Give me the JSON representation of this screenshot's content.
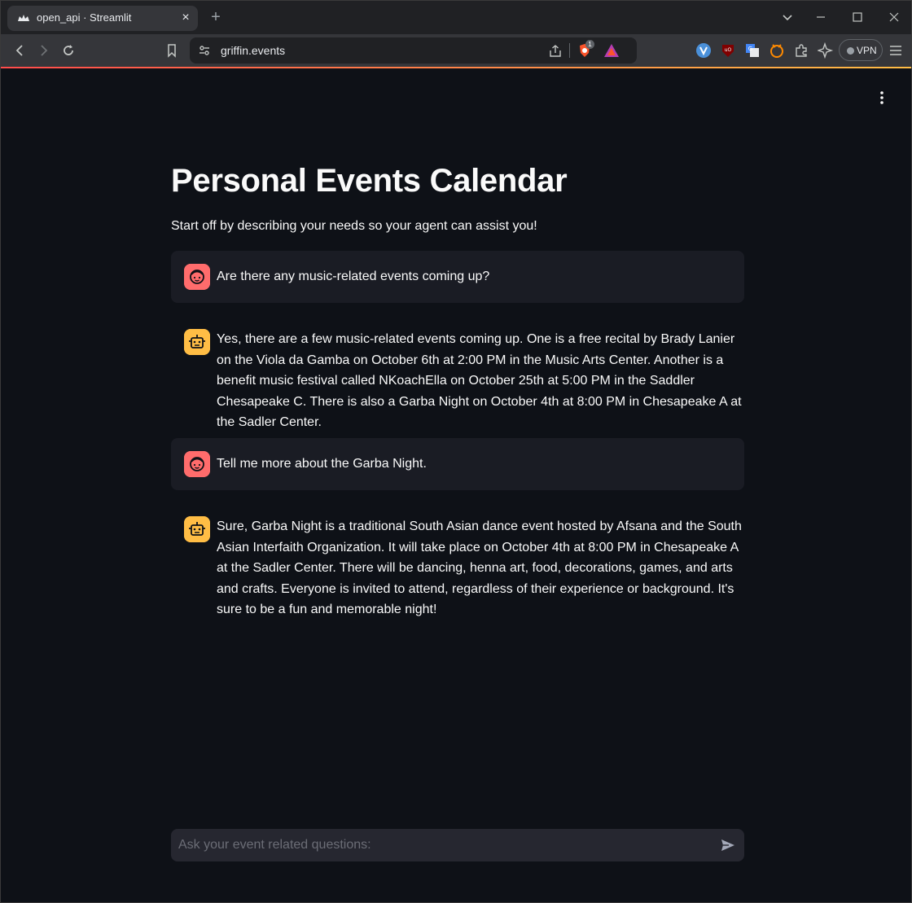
{
  "browser": {
    "tab_title": "open_api · Streamlit",
    "url": "griffin.events",
    "vpn_label": "VPN",
    "brave_badge_count": "1"
  },
  "app": {
    "title": "Personal Events Calendar",
    "subtitle": "Start off by describing your needs so your agent can assist you!",
    "messages": [
      {
        "role": "user",
        "text": "Are there any music-related events coming up?"
      },
      {
        "role": "assistant",
        "text": "Yes, there are a few music-related events coming up. One is a free recital by Brady Lanier on the Viola da Gamba on October 6th at 2:00 PM in the Music Arts Center. Another is a benefit music festival called NKoachElla on October 25th at 5:00 PM in the Saddler Chesapeake C. There is also a Garba Night on October 4th at 8:00 PM in Chesapeake A at the Sadler Center."
      },
      {
        "role": "user",
        "text": "Tell me more about the Garba Night."
      },
      {
        "role": "assistant",
        "text": "Sure, Garba Night is a traditional South Asian dance event hosted by Afsana and the South Asian Interfaith Organization. It will take place on October 4th at 8:00 PM in Chesapeake A at the Sadler Center. There will be dancing, henna art, food, decorations, games, and arts and crafts. Everyone is invited to attend, regardless of their experience or background. It's sure to be a fun and memorable night!"
      }
    ],
    "chat_input": {
      "placeholder": "Ask your event related questions:",
      "value": ""
    }
  },
  "colors": {
    "background": "#0e1117",
    "user_message_bg": "#1a1c24",
    "user_avatar": "#ff6c6c",
    "assistant_avatar": "#ffbd45",
    "input_bg": "#262730"
  }
}
